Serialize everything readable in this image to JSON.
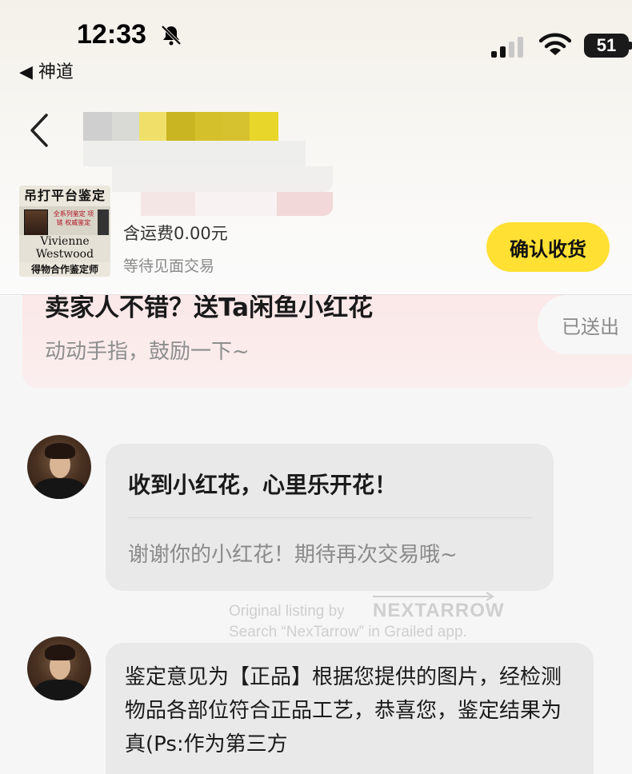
{
  "status_bar": {
    "time": "12:33",
    "back_app": "◀ 神道",
    "battery": "51",
    "icons": [
      "bell-slash-icon",
      "signal-icon",
      "wifi-icon",
      "battery-icon"
    ]
  },
  "nav": {
    "back_icon": "chevron-left-icon"
  },
  "product": {
    "thumb_top": "吊打平台鉴定",
    "thumb_small": "全系列鉴定 项链 权威鉴定",
    "thumb_brand_line1": "Vivienne",
    "thumb_brand_line2": "Westwood",
    "thumb_bottom": "得物合作鉴定师",
    "shipping": "含运费0.00元",
    "trade_status": "等待见面交易",
    "confirm_label": "确认收货"
  },
  "flower_card": {
    "title": "卖家人不错？送Ta闲鱼小红花",
    "subtitle": "动动手指，鼓励一下~",
    "sent_label": "已送出"
  },
  "messages": [
    {
      "title": "收到小红花，心里乐开花！",
      "text": "谢谢你的小红花！期待再次交易哦~"
    },
    {
      "text": "鉴定意见为【正品】根据您提供的图片，经检测物品各部位符合正品工艺，恭喜您，鉴定结果为真(Ps:作为第三方"
    }
  ],
  "watermark": {
    "line1": "Original listing by",
    "brand": "NEXTARROW",
    "line2": "Search “NexTarrow” in Grailed app."
  },
  "colors": {
    "accent_yellow": "#ffe033",
    "flower_card_bg": "#fbe8e8",
    "bubble_bg": "#e9e9ea"
  }
}
